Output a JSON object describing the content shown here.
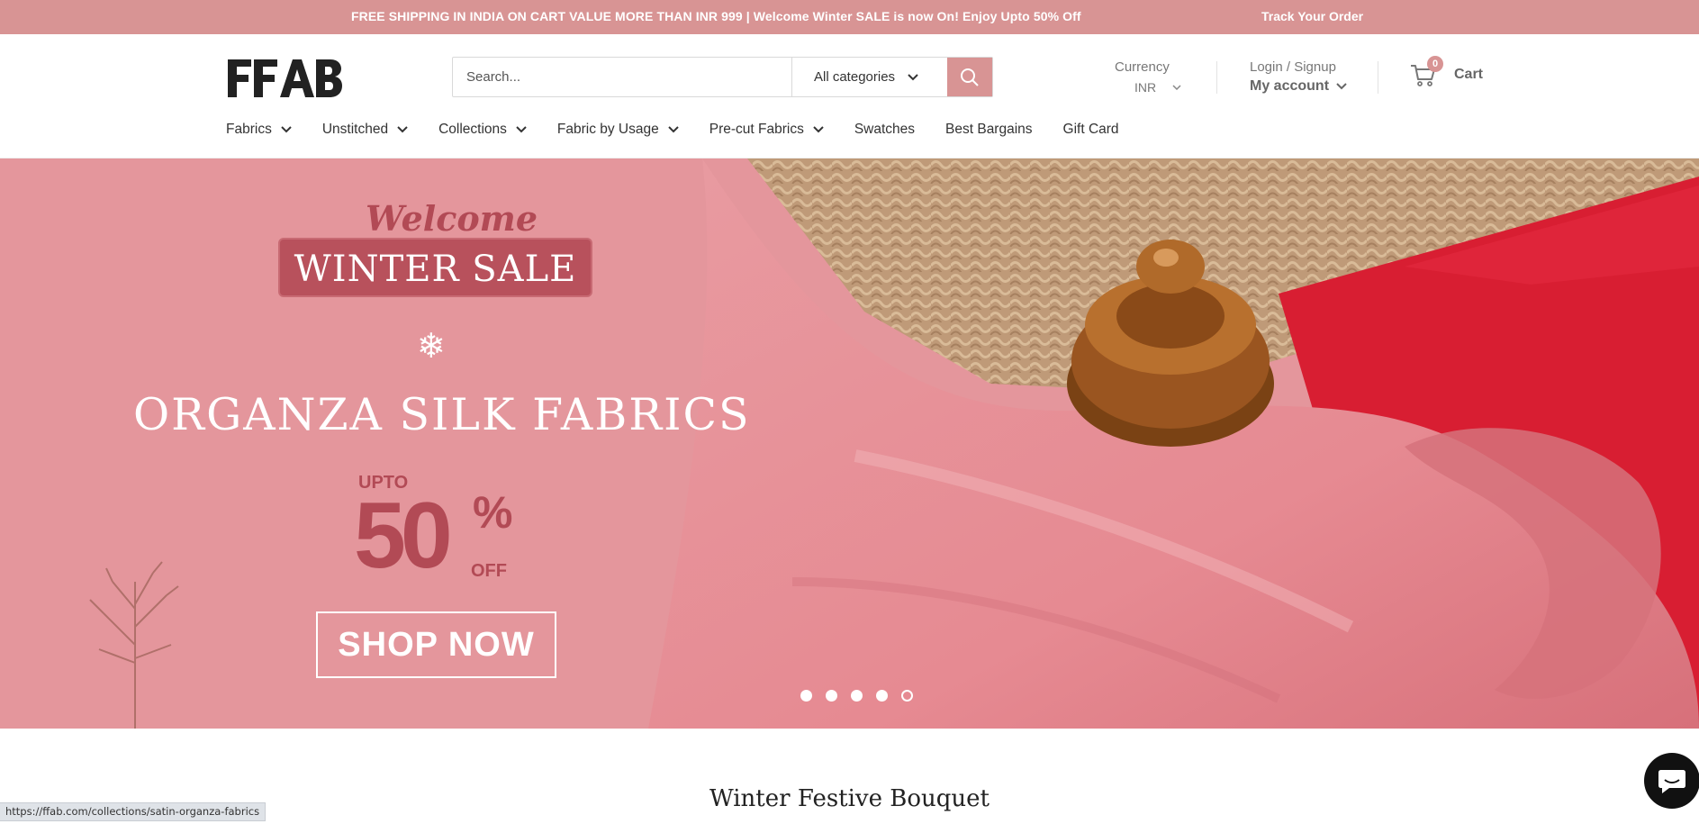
{
  "announcement": {
    "message": "FREE SHIPPING IN INDIA ON CART VALUE MORE THAN INR 999 | Welcome Winter SALE is now On! Enjoy Upto 50% Off",
    "track_order": "Track Your Order"
  },
  "header": {
    "logo_text": "FFAB",
    "search": {
      "placeholder": "Search...",
      "category": "All categories"
    },
    "currency": {
      "label": "Currency",
      "value": "INR"
    },
    "account": {
      "login": "Login / Signup",
      "my_account": "My account"
    },
    "cart": {
      "count": "0",
      "label": "Cart"
    }
  },
  "nav": {
    "items": [
      {
        "label": "Fabrics",
        "has_dropdown": true
      },
      {
        "label": "Unstitched",
        "has_dropdown": true
      },
      {
        "label": "Collections",
        "has_dropdown": true
      },
      {
        "label": "Fabric by Usage",
        "has_dropdown": true
      },
      {
        "label": "Pre-cut Fabrics",
        "has_dropdown": true
      },
      {
        "label": "Swatches",
        "has_dropdown": false
      },
      {
        "label": "Best Bargains",
        "has_dropdown": false
      },
      {
        "label": "Gift Card",
        "has_dropdown": false
      }
    ]
  },
  "hero": {
    "welcome": "Welcome",
    "sale": "WINTER SALE",
    "product": "ORGANZA SILK FABRICS",
    "upto": "UPTO",
    "discount": "50",
    "percent": "%",
    "off": "OFF",
    "cta": "SHOP NOW",
    "slides": 5,
    "active_slide": 5
  },
  "section": {
    "title": "Winter Festive Bouquet"
  },
  "status_url": "https://ffab.com/collections/satin-organza-fabrics",
  "colors": {
    "brand": "#d89494",
    "accent_dark": "#b24a55"
  },
  "icons": [
    "search-icon",
    "chevron-down-icon",
    "cart-icon",
    "chat-icon",
    "snowflake-icon"
  ]
}
